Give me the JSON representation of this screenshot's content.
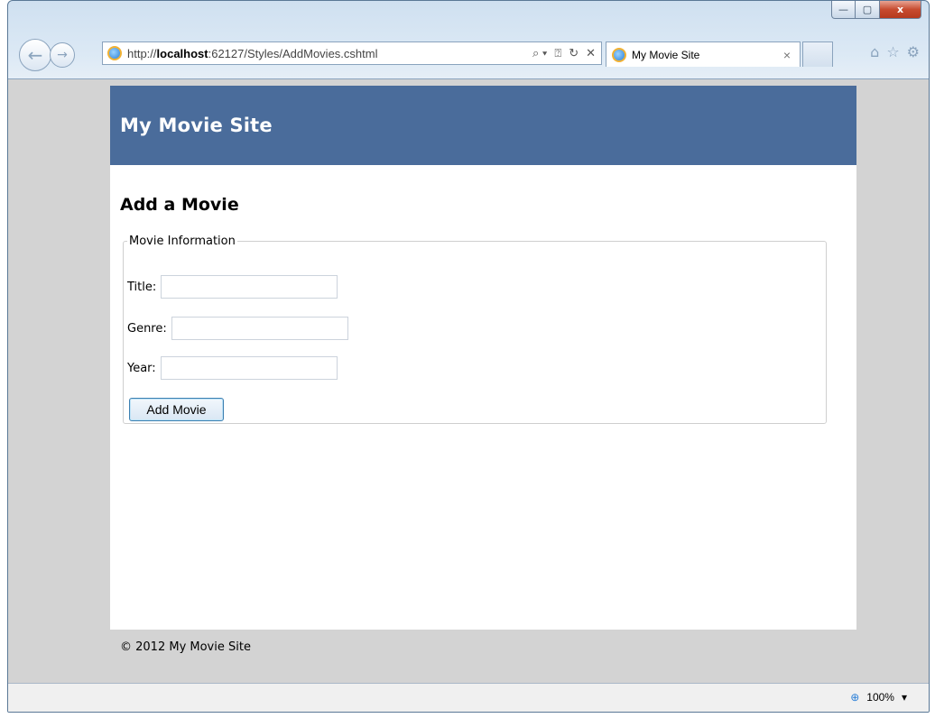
{
  "browser": {
    "address_url_prefix": "http://",
    "address_url_host": "localhost",
    "address_url_rest": ":62127/Styles/AddMovies.cshtml",
    "address_tools": [
      "⌕ ▾",
      "⍰",
      "↻",
      "✕"
    ],
    "tab_title": "My Movie Site",
    "tab_close": "×",
    "caption": {
      "minimize": "—",
      "maximize": "▢",
      "close": "x"
    },
    "icons": {
      "home": "⌂",
      "favorites": "☆",
      "tools": "⚙",
      "back": "←",
      "forward": "→"
    },
    "status_zoom": "100%",
    "status_zoom_icon": "⊕",
    "status_zoom_dropdown": "▾"
  },
  "site": {
    "title": "My Movie Site",
    "header_color": "#4a6c9b"
  },
  "page": {
    "heading": "Add a Movie",
    "fieldset_legend": "Movie Information",
    "fields": {
      "title_label": "Title:",
      "genre_label": "Genre:",
      "year_label": "Year:"
    },
    "submit_label": "Add Movie",
    "footer": "© 2012 My Movie Site"
  }
}
